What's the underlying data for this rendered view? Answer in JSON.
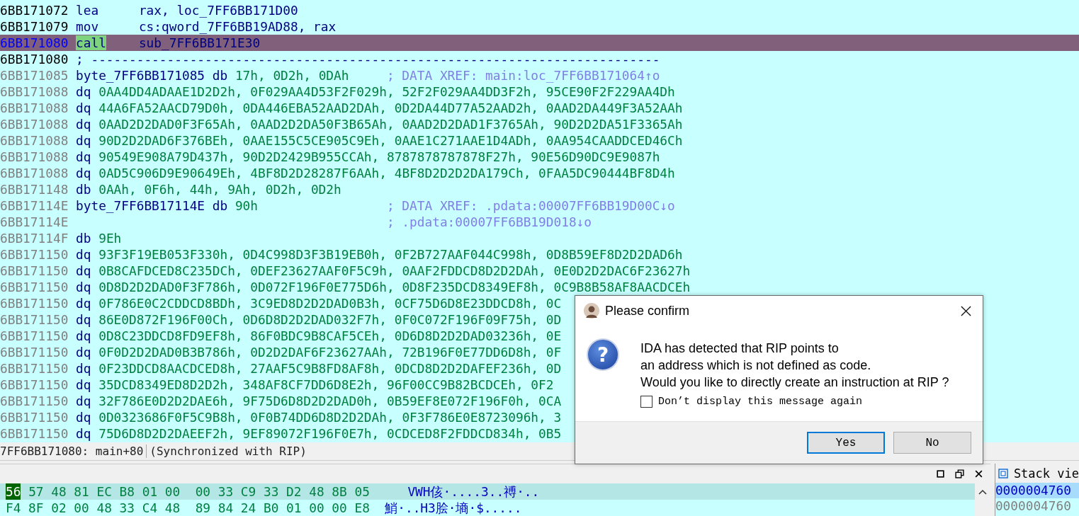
{
  "listing": {
    "lines": [
      {
        "kind": "code",
        "address": "6BB171072",
        "mnemonic": "lea",
        "operands": "rax, loc_7FF6BB171D00",
        "selected": false
      },
      {
        "kind": "code",
        "address": "6BB171079",
        "mnemonic": "mov",
        "operands": "cs:qword_7FF6BB19AD88, rax",
        "selected": false
      },
      {
        "kind": "code",
        "address": "6BB171080",
        "mnemonic": "call",
        "operands": "sub_7FF6BB171E30",
        "selected": true
      },
      {
        "kind": "separator",
        "address": "6BB171080",
        "comment": "; ---------------------------------------------------------------------------",
        "selected": false
      },
      {
        "kind": "data",
        "address": "6BB171085",
        "label": "byte_7FF6BB171085",
        "mnemonic": "db",
        "operands": "17h, 0D2h, 0DAh",
        "comment": "; DATA XREF: main:loc_7FF6BB171064↑o",
        "selected": false
      },
      {
        "kind": "data",
        "address": "6BB171088",
        "mnemonic": "dq",
        "operands": "0AA4DD4ADAAE1D2D2h, 0F029AA4D53F2F029h, 52F2F029AA4DD3F2h, 95CE90F2F229AA4Dh",
        "selected": false
      },
      {
        "kind": "data",
        "address": "6BB171088",
        "mnemonic": "dq",
        "operands": "44A6FA52AACD79D0h, 0DA446EBA52AAD2DAh, 0D2DA44D77A52AAD2h, 0AAD2DA449F3A52AAh",
        "selected": false
      },
      {
        "kind": "data",
        "address": "6BB171088",
        "mnemonic": "dq",
        "operands": "0AAD2D2DAD0F3F65Ah, 0AAD2D2DA50F3B65Ah, 0AAD2D2DAD1F3765Ah, 90D2D2DA51F3365Ah",
        "selected": false
      },
      {
        "kind": "data",
        "address": "6BB171088",
        "mnemonic": "dq",
        "operands": "90D2D2DAD6F376BEh, 0AAE155C5CE905C9Eh, 0AAE1C271AAE1D4ADh, 0AA954CAADDCED46Ch",
        "selected": false
      },
      {
        "kind": "data",
        "address": "6BB171088",
        "mnemonic": "dq",
        "operands": "90549E908A79D437h, 90D2D2429B955CCAh, 8787878787878F27h, 90E56D90DC9E9087h",
        "selected": false
      },
      {
        "kind": "data",
        "address": "6BB171088",
        "mnemonic": "dq",
        "operands": "0AD5C906D9E90649Eh, 4BF8D2D28287F6AAh, 4BF8D2D2D2DA179Ch, 0FAA5DC90444BF8D4h",
        "selected": false
      },
      {
        "kind": "data",
        "address": "6BB171148",
        "mnemonic": "db",
        "operands": "0AAh, 0F6h, 44h, 9Ah, 0D2h, 0D2h",
        "selected": false
      },
      {
        "kind": "data",
        "address": "6BB17114E",
        "label": "byte_7FF6BB17114E",
        "mnemonic": "db",
        "operands": "90h",
        "comment": "; DATA XREF: .pdata:00007FF6BB19D00C↓o",
        "selected": false
      },
      {
        "kind": "data",
        "address": "6BB17114E",
        "comment": "; .pdata:00007FF6BB19D018↓o",
        "selected": false
      },
      {
        "kind": "data",
        "address": "6BB17114F",
        "mnemonic": "db",
        "operands": "9Eh",
        "selected": false
      },
      {
        "kind": "data",
        "address": "6BB171150",
        "mnemonic": "dq",
        "operands": "93F3F19EB053F330h, 0D4C998D3F3B19EB0h, 0F2B727AAF044C998h, 0D8B59EF8D2D2DAD6h",
        "selected": false
      },
      {
        "kind": "data",
        "address": "6BB171150",
        "mnemonic": "dq",
        "operands": "0B8CAFDCED8C235DCh, 0DEF23627AAF0F5C9h, 0AAF2FDDCD8D2D2DAh, 0E0D2D2DAC6F23627h",
        "selected": false
      },
      {
        "kind": "data",
        "address": "6BB171150",
        "mnemonic": "dq",
        "operands": "0D8D2D2DAD0F3F786h, 0D072F196F0E775D6h, 0D8F235DCD8349EF8h, 0C9B8B58AF8AACDCEh",
        "selected": false
      },
      {
        "kind": "data",
        "address": "6BB171150",
        "mnemonic": "dq",
        "operands": "0F786E0C2CDDCD8BDh, 3C9ED8D2D2DAD0B3h, 0CF75D6D8E23DDCD8h, 0C",
        "selected": false
      },
      {
        "kind": "data",
        "address": "6BB171150",
        "mnemonic": "dq",
        "operands": "86E0D872F196F00Ch, 0D6D8D2D2DAD032F7h, 0F0C072F196F09F75h, 0D",
        "selected": false
      },
      {
        "kind": "data",
        "address": "6BB171150",
        "mnemonic": "dq",
        "operands": "0D8C23DDCD8FD9EF8h, 86F0BDC9B8CAF5CEh, 0D6D8D2D2DAD03236h, 0E",
        "selected": false
      },
      {
        "kind": "data",
        "address": "6BB171150",
        "mnemonic": "dq",
        "operands": "0F0D2D2DAD0B3B786h, 0D2D2DAF6F23627AAh, 72B196F0E77DD6D8h, 0F",
        "selected": false
      },
      {
        "kind": "data",
        "address": "6BB171150",
        "mnemonic": "dq",
        "operands": "0F23DDCD8AACDCED8h, 27AAF5C9B8FD8AF8h, 0DCD8D2D2DAFEF236h, 0D",
        "selected": false
      },
      {
        "kind": "data",
        "address": "6BB171150",
        "mnemonic": "dq",
        "operands": "35DCD8349ED8D2D2h, 348AF8CF7DD6D8E2h, 96F00CC9B82BCDCEh, 0F2",
        "selected": false
      },
      {
        "kind": "data",
        "address": "6BB171150",
        "mnemonic": "dq",
        "operands": "32F786E0D2D2DAE6h, 9F75D6D8D2D2DAD0h, 0B59EF8E072F196F0h, 0CA",
        "selected": false
      },
      {
        "kind": "data",
        "address": "6BB171150",
        "mnemonic": "dq",
        "operands": "0D0323686F0F5C9B8h, 0F0B74DD6D8D2D2DAh, 0F3F786E0E8723096h, 3",
        "selected": false
      },
      {
        "kind": "data",
        "address": "6BB171150",
        "mnemonic": "dq",
        "operands": "75D6D8D2D2DAEEF2h, 9EF89072F196F0E7h, 0CDCED8F2FDDCD834h, 0B5",
        "selected": false
      }
    ]
  },
  "status_bar": {
    "location": "7FF6BB171080: main+80",
    "sync": "(Synchronized with RIP)"
  },
  "hex_view": {
    "rows": [
      {
        "cursor": "56",
        "bytes": "57 48 81 EC B8 01 00  00 33 C9 33 D2 48 8B 05",
        "ascii": "VWH侅·....3..禣·..",
        "selected": true
      },
      {
        "bytes": "F4 8F 02 00 48 33 C4 48  89 84 24 B0 01 00 00 E8",
        "ascii": "鮹·..H3脍·墒·$.....",
        "selected": false
      }
    ]
  },
  "stack_view": {
    "title": "Stack vie",
    "rows": [
      {
        "value": "0000004760",
        "selected": true
      },
      {
        "value": "0000004760",
        "selected": false
      }
    ]
  },
  "dialog": {
    "title": "Please confirm",
    "icon": "?",
    "message": [
      "IDA has detected that RIP points to",
      "an address which is not defined as code.",
      "Would you like to directly create an instruction at RIP ?"
    ],
    "checkbox": {
      "label": "Don’t display this message again",
      "checked": false
    },
    "buttons": [
      {
        "label": "Yes",
        "focused": true
      },
      {
        "label": "No",
        "focused": false
      }
    ]
  }
}
